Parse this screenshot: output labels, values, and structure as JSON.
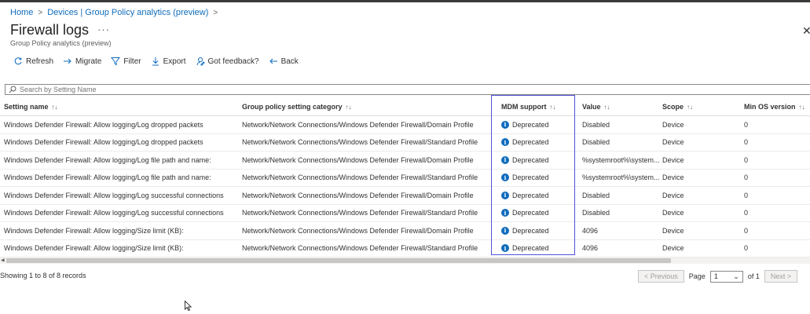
{
  "breadcrumb": {
    "items": [
      "Home",
      "Devices | Group Policy analytics (preview)"
    ]
  },
  "page": {
    "title": "Firewall logs",
    "subtitle": "Group Policy analytics (preview)",
    "more": "···"
  },
  "toolbar": {
    "refresh": "Refresh",
    "migrate": "Migrate",
    "filter": "Filter",
    "export": "Export",
    "feedback": "Got feedback?",
    "back": "Back"
  },
  "search": {
    "placeholder": "Search by Setting Name",
    "value": ""
  },
  "table": {
    "columns": [
      "Setting name",
      "Group policy setting category",
      "MDM support",
      "Value",
      "Scope",
      "Min OS version"
    ],
    "sort_glyph": "↑↓",
    "rows": [
      [
        "Windows Defender Firewall: Allow logging/Log dropped packets",
        "Network/Network Connections/Windows Defender Firewall/Domain Profile",
        "Deprecated",
        "Disabled",
        "Device",
        "0"
      ],
      [
        "Windows Defender Firewall: Allow logging/Log dropped packets",
        "Network/Network Connections/Windows Defender Firewall/Standard Profile",
        "Deprecated",
        "Disabled",
        "Device",
        "0"
      ],
      [
        "Windows Defender Firewall: Allow logging/Log file path and name:",
        "Network/Network Connections/Windows Defender Firewall/Domain Profile",
        "Deprecated",
        "%systemroot%\\system...",
        "Device",
        "0"
      ],
      [
        "Windows Defender Firewall: Allow logging/Log file path and name:",
        "Network/Network Connections/Windows Defender Firewall/Standard Profile",
        "Deprecated",
        "%systemroot%\\system...",
        "Device",
        "0"
      ],
      [
        "Windows Defender Firewall: Allow logging/Log successful connections",
        "Network/Network Connections/Windows Defender Firewall/Domain Profile",
        "Deprecated",
        "Disabled",
        "Device",
        "0"
      ],
      [
        "Windows Defender Firewall: Allow logging/Log successful connections",
        "Network/Network Connections/Windows Defender Firewall/Standard Profile",
        "Deprecated",
        "Disabled",
        "Device",
        "0"
      ],
      [
        "Windows Defender Firewall: Allow logging/Size limit (KB):",
        "Network/Network Connections/Windows Defender Firewall/Domain Profile",
        "Deprecated",
        "4096",
        "Device",
        "0"
      ],
      [
        "Windows Defender Firewall: Allow logging/Size limit (KB):",
        "Network/Network Connections/Windows Defender Firewall/Standard Profile",
        "Deprecated",
        "4096",
        "Device",
        "0"
      ]
    ]
  },
  "footer": {
    "records": "Showing 1 to 8 of 8 records",
    "prev": "< Previous",
    "page_label": "Page",
    "page_value": "1",
    "of": "of 1",
    "next": "Next >"
  },
  "colors": {
    "accent": "#0f6cbd",
    "highlight": "#4f52d8"
  }
}
